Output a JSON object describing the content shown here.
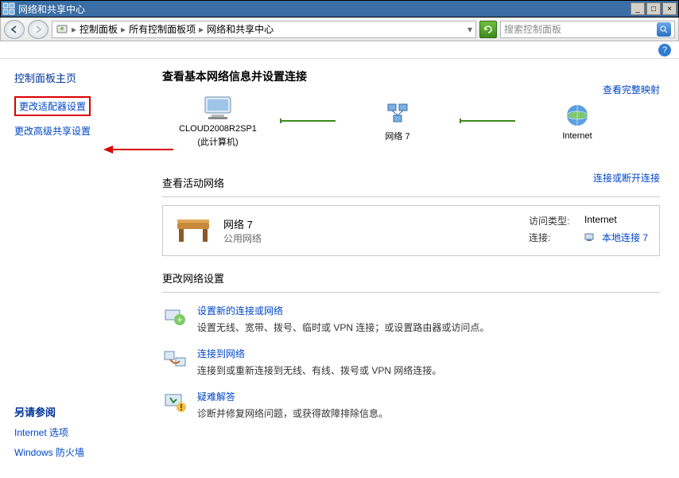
{
  "window": {
    "title": "网络和共享中心",
    "minimize": "_",
    "maximize": "□",
    "close": "×"
  },
  "nav": {
    "back": "◀",
    "forward": "▶",
    "go": "→",
    "breadcrumb": {
      "root": "控制面板",
      "mid": "所有控制面板项",
      "leaf": "网络和共享中心",
      "sep": "▸"
    },
    "search_placeholder": "搜索控制面板"
  },
  "help": {
    "icon": "?"
  },
  "sidebar": {
    "home": "控制面板主页",
    "links": {
      "adapter": "更改适配器设置",
      "advanced": "更改高级共享设置"
    },
    "seealso": {
      "heading": "另请参阅",
      "internet_options": "Internet 选项",
      "firewall": "Windows 防火墙"
    }
  },
  "main": {
    "heading": "查看基本网络信息并设置连接",
    "map": {
      "this_pc": "CLOUD2008R2SP1",
      "this_pc_sub": "(此计算机)",
      "network": "网络  7",
      "internet": "Internet",
      "view_full": "查看完整映射"
    },
    "active": {
      "title": "查看活动网络",
      "change": "连接或断开连接",
      "name": "网络  7",
      "type": "公用网络",
      "access_label": "访问类型:",
      "access_value": "Internet",
      "conn_label": "连接:",
      "conn_value": "本地连接 7"
    },
    "settings": {
      "title": "更改网络设置",
      "tasks": [
        {
          "link": "设置新的连接或网络",
          "desc": "设置无线、宽带、拨号、临时或 VPN 连接；或设置路由器或访问点。"
        },
        {
          "link": "连接到网络",
          "desc": "连接到或重新连接到无线、有线、拨号或 VPN 网络连接。"
        },
        {
          "link": "疑难解答",
          "desc": "诊断并修复网络问题，或获得故障排除信息。"
        }
      ]
    }
  }
}
